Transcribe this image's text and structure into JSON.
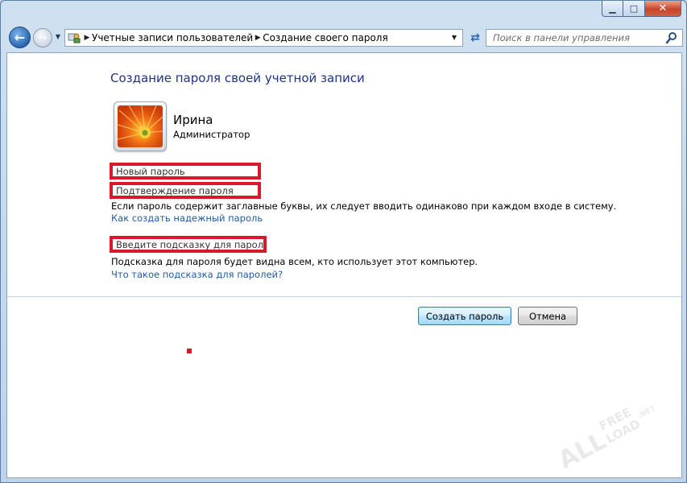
{
  "window": {
    "caption_buttons": {
      "minimize": "▁",
      "maximize": "□",
      "close": "✕"
    }
  },
  "toolbar": {
    "breadcrumbs": [
      "Учетные записи пользователей",
      "Создание своего пароля"
    ],
    "search_placeholder": "Поиск в панели управления"
  },
  "main": {
    "title": "Создание пароля своей учетной записи",
    "user": {
      "name": "Ирина",
      "role": "Администратор"
    },
    "fields": {
      "new_password_placeholder": "Новый пароль",
      "confirm_password_placeholder": "Подтверждение пароля",
      "hint_placeholder": "Введите подсказку для пароля"
    },
    "caps_note": "Если пароль содержит заглавные буквы, их следует вводить одинаково при каждом входе в систему.",
    "strong_password_link": "Как создать надежный пароль",
    "hint_note": "Подсказка для пароля будет видна всем, кто использует этот компьютер.",
    "hint_link": "Что такое подсказка для паролей?",
    "buttons": {
      "create": "Создать пароль",
      "cancel": "Отмена"
    }
  },
  "watermark": {
    "line1": "ALL",
    "line2": "FREE",
    "line3": "LOAD",
    "suffix": ".NET"
  },
  "colors": {
    "accent_red": "#d9182b",
    "title_blue": "#1e3287",
    "link_blue": "#1d5ca8"
  },
  "icons": [
    "back-arrow-icon",
    "forward-arrow-icon",
    "control-panel-icon",
    "refresh-icon",
    "search-icon"
  ]
}
